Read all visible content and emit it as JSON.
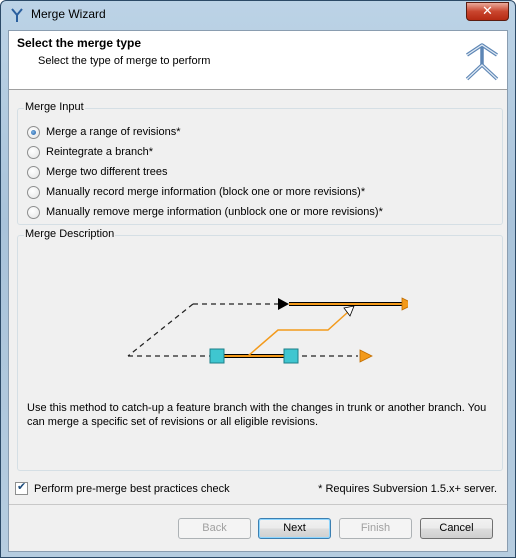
{
  "window": {
    "title": "Merge Wizard",
    "close_label": "✕"
  },
  "header": {
    "title": "Select the merge type",
    "subtitle": "Select the type of merge to perform"
  },
  "merge_input": {
    "label": "Merge Input",
    "options": [
      {
        "label": "Merge a range of revisions*",
        "checked": true
      },
      {
        "label": "Reintegrate a branch*",
        "checked": false
      },
      {
        "label": "Merge two different trees",
        "checked": false
      },
      {
        "label": "Manually record merge information (block one or more revisions)*",
        "checked": false
      },
      {
        "label": "Manually remove merge information (unblock one or more revisions)*",
        "checked": false
      }
    ]
  },
  "merge_description": {
    "label": "Merge Description",
    "text": "Use this method to catch-up a feature branch with the changes in trunk or another branch.  You can merge a specific set of revisions or all eligible revisions."
  },
  "premerge_check": {
    "label": "Perform pre-merge best practices check",
    "checked": true
  },
  "note": "* Requires Subversion 1.5.x+ server.",
  "buttons": {
    "back": "Back",
    "next": "Next",
    "finish": "Finish",
    "cancel": "Cancel"
  },
  "colors": {
    "accent_orange": "#f39a1b",
    "marker_cyan": "#3fc6d0",
    "header_icon": "#5d86b5"
  }
}
